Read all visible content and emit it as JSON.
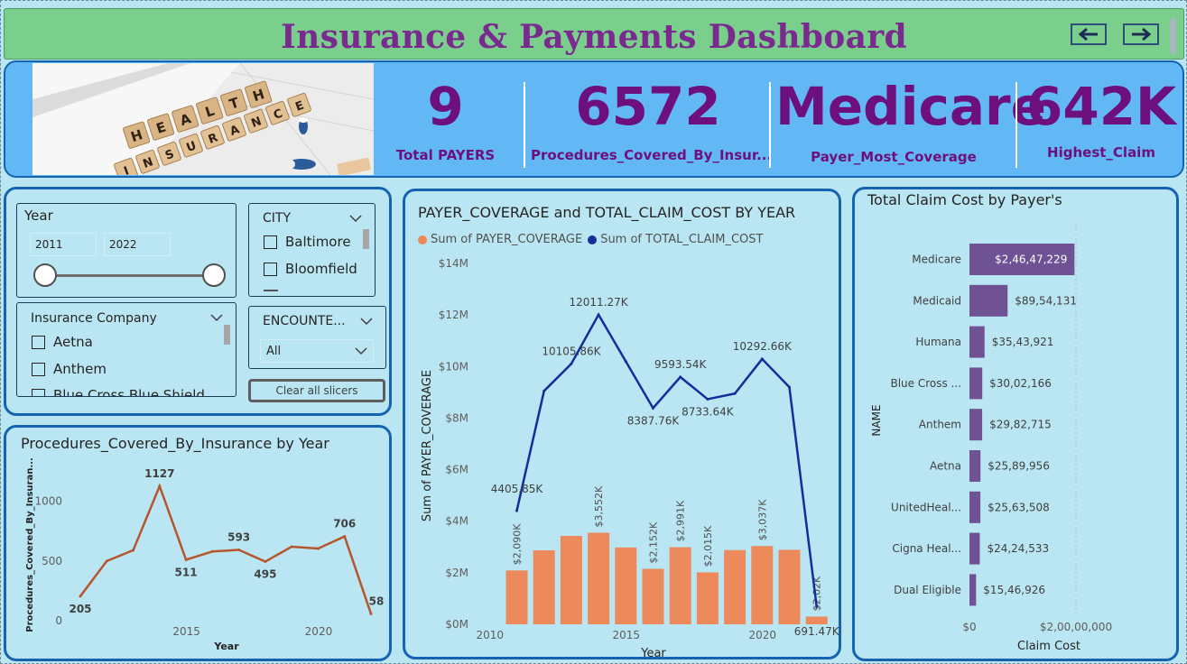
{
  "header": {
    "title": "Insurance & Payments Dashboard",
    "nav": [
      "back-arrow-icon",
      "forward-arrow-icon"
    ]
  },
  "hero_image": {
    "tiles_top": [
      "H",
      "E",
      "A",
      "L",
      "T",
      "H"
    ],
    "tiles_bottom": [
      "I",
      "N",
      "S",
      "U",
      "R",
      "A",
      "N",
      "C",
      "E"
    ]
  },
  "kpis": [
    {
      "value": "9",
      "label": "Total PAYERS"
    },
    {
      "value": "6572",
      "label": "Procedures_Covered_By_Insur..."
    },
    {
      "value": "Medicare",
      "label": "Payer_Most_Coverage"
    },
    {
      "value": "642K",
      "label": "Highest_Claim"
    }
  ],
  "slicers": {
    "year": {
      "title": "Year",
      "from": "2011",
      "to": "2022"
    },
    "city": {
      "title": "CITY",
      "items": [
        "Baltimore",
        "Bloomfield"
      ]
    },
    "insurance_company": {
      "title": "Insurance Company",
      "items": [
        "Aetna",
        "Anthem",
        "Blue Cross Blue Shield"
      ]
    },
    "encounter": {
      "title": "ENCOUNTE...",
      "selected": "All"
    },
    "clear_button": "Clear all slicers"
  },
  "chart_data": [
    {
      "type": "line",
      "title": "Procedures_Covered_By_Insurance by Year",
      "xlabel": "Year",
      "ylabel": "Procedures_Covered_By_Insuran...",
      "x": [
        2011,
        2012,
        2013,
        2014,
        2015,
        2016,
        2017,
        2018,
        2019,
        2020,
        2021,
        2022
      ],
      "values": [
        205,
        500,
        590,
        1127,
        511,
        580,
        593,
        495,
        620,
        605,
        706,
        58
      ],
      "labels": [
        "205",
        "",
        "",
        "1127",
        "511",
        "",
        "593",
        "495",
        "",
        "",
        "706",
        "58"
      ],
      "yticks": [
        "0",
        "500",
        "1000"
      ],
      "xticks": [
        "2015",
        "2020"
      ],
      "ylim": [
        0,
        1300
      ],
      "color": "#b5562c"
    },
    {
      "type": "bar+line",
      "title": "PAYER_COVERAGE and TOTAL_CLAIM_COST BY YEAR",
      "xlabel": "Year",
      "ylabel": "Sum of PAYER_COVERAGE",
      "legend": [
        "Sum of PAYER_COVERAGE",
        "Sum of TOTAL_CLAIM_COST"
      ],
      "legend_colors": [
        "#ec8a5b",
        "#142d9a"
      ],
      "x": [
        2011,
        2012,
        2013,
        2014,
        2015,
        2016,
        2017,
        2018,
        2019,
        2020,
        2021,
        2022
      ],
      "bar_values": [
        2.09,
        2.87,
        3.43,
        3.552,
        2.98,
        2.152,
        2.991,
        2.015,
        2.88,
        3.037,
        2.89,
        0.3
      ],
      "bar_labels": [
        "$2,090K",
        "",
        "",
        "$3,552K",
        "",
        "$2,152K",
        "$2,991K",
        "$2,015K",
        "",
        "$3,037K",
        "",
        "$2,02K"
      ],
      "line_values": [
        4.40585,
        9.05,
        10.10586,
        12.01127,
        10.2,
        8.38776,
        9.59354,
        8.73364,
        8.95,
        10.29266,
        9.2,
        0.69147
      ],
      "line_labels": [
        "4405.85K",
        "",
        "10105.86K",
        "12011.27K",
        "",
        "8387.76K",
        "9593.54K",
        "8733.64K",
        "",
        "10292.66K",
        "",
        "691.47K"
      ],
      "yticks": [
        "$0M",
        "$2M",
        "$4M",
        "$6M",
        "$8M",
        "$10M",
        "$12M",
        "$14M"
      ],
      "xticks": [
        "2010",
        "2015",
        "2020"
      ],
      "ylim": [
        0,
        14
      ]
    },
    {
      "type": "bar",
      "orientation": "horizontal",
      "title": "Total Claim Cost by Payer's",
      "xlabel": "Claim Cost",
      "ylabel": "NAME",
      "categories": [
        "Medicare",
        "Medicaid",
        "Humana",
        "Blue Cross ...",
        "Anthem",
        "Aetna",
        "UnitedHeal...",
        "Cigna Heal...",
        "Dual Eligible"
      ],
      "values": [
        24647229,
        8954131,
        3543921,
        3002166,
        2982715,
        2589956,
        2563508,
        2424533,
        1546926
      ],
      "value_labels": [
        "$2,46,47,229",
        "$89,54,131",
        "$35,43,921",
        "$30,02,166",
        "$29,82,715",
        "$25,89,956",
        "$25,63,508",
        "$24,24,533",
        "$15,46,926"
      ],
      "xticks": [
        "$0",
        "$2,00,00,000"
      ],
      "xlim": [
        0,
        25000000
      ],
      "color": "#6e5294"
    }
  ]
}
